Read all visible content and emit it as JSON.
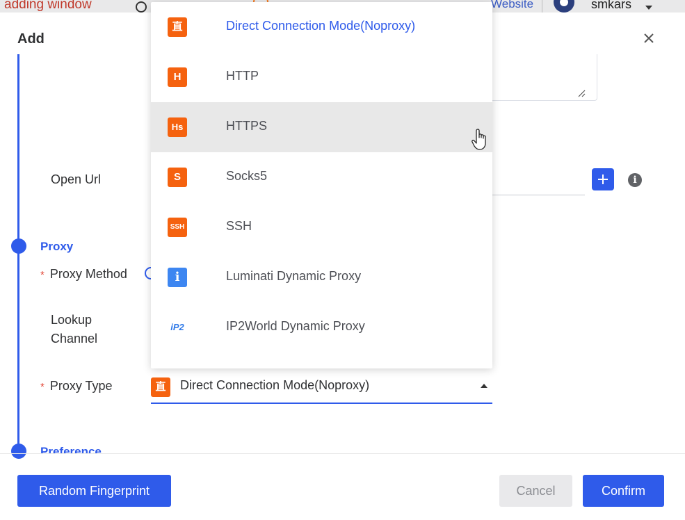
{
  "background_app": {
    "window_title": "adding window",
    "website_link": "Website",
    "username": "smkars"
  },
  "dialog": {
    "title": "Add",
    "close_label": "×",
    "fields": {
      "open_url_label": "Open Url",
      "proxy_section": "Proxy",
      "proxy_method_label": "Proxy Method",
      "lookup_channel_label": "Lookup Channel",
      "proxy_type_label": "Proxy Type",
      "preference_section": "Preference",
      "required_mark": "*",
      "info_icon": "i"
    },
    "proxy_type": {
      "selected_value": "Direct Connection Mode(Noproxy)",
      "selected_icon_glyph": "直"
    },
    "dropdown_options": [
      {
        "label": "Direct Connection Mode(Noproxy)",
        "icon_glyph": "直",
        "icon": "direct-icon",
        "selected": true
      },
      {
        "label": "HTTP",
        "icon_glyph": "H",
        "icon": "http-icon"
      },
      {
        "label": "HTTPS",
        "icon_glyph": "Hs",
        "icon": "https-icon",
        "hovered": true
      },
      {
        "label": "Socks5",
        "icon_glyph": "S",
        "icon": "socks5-icon"
      },
      {
        "label": "SSH",
        "icon_glyph": "SSH",
        "icon": "ssh-icon"
      },
      {
        "label": "Luminati Dynamic Proxy",
        "icon_glyph": "i",
        "icon": "luminati-icon"
      },
      {
        "label": "IP2World Dynamic Proxy",
        "icon_glyph": "iP2",
        "icon": "ip2world-icon"
      }
    ],
    "footer": {
      "random_fingerprint": "Random Fingerprint",
      "cancel": "Cancel",
      "confirm": "Confirm"
    }
  },
  "colors": {
    "primary": "#2f5bea",
    "icon_orange": "#f5620f",
    "hover_bg": "#e8e8e8"
  }
}
